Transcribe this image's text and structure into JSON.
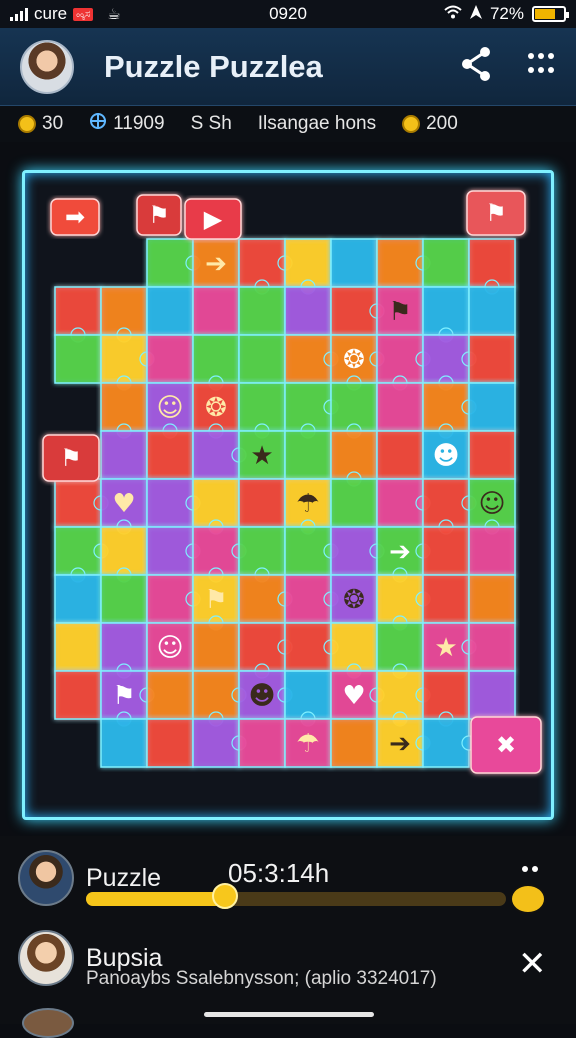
{
  "status_bar": {
    "carrier": "cure",
    "carrier_badge": "ೲಕಸ",
    "time": "0920",
    "battery": "72%"
  },
  "header": {
    "title": "Puzzle Puzzlea",
    "icons": [
      "share-icon",
      "more-icon"
    ]
  },
  "stats": {
    "coins_left": "30",
    "score": "11909",
    "mode": "S Sh",
    "label": "Ilsangae hons",
    "coins_right": "200"
  },
  "board": {
    "accent_color": "#7ff0ff",
    "pieces_colors": [
      "#f04b3a",
      "#f5851f",
      "#ffd02a",
      "#55d24a",
      "#29b6e8",
      "#a25be0",
      "#e84a9a"
    ],
    "stickers": [
      "arrow-icon",
      "flag-icon",
      "bug-icon",
      "cat-icon",
      "star-icon",
      "frog-icon",
      "heart-icon",
      "ghost-icon"
    ]
  },
  "players": [
    {
      "name": "Puzzle",
      "timer": "05:3:14h",
      "progress": 0.33
    },
    {
      "name": "Bupsia",
      "message": "Panoaybs Ssalebnysson; (aplio 3324017)"
    }
  ]
}
